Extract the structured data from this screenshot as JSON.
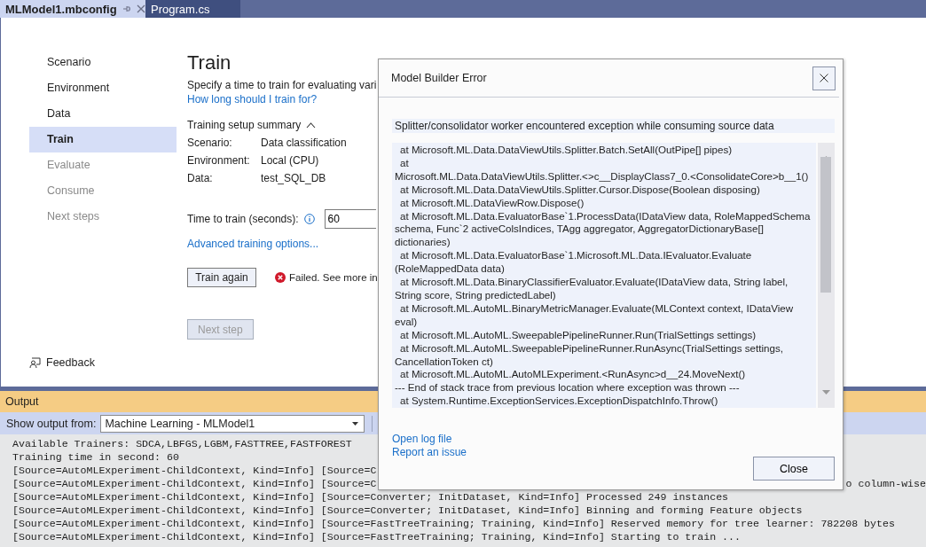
{
  "tabs": [
    {
      "label": "MLModel1.mbconfig",
      "selected": true
    },
    {
      "label": "Program.cs",
      "selected": false
    }
  ],
  "sidebar": {
    "items": [
      {
        "label": "Scenario",
        "selected": false,
        "disabled": false
      },
      {
        "label": "Environment",
        "selected": false,
        "disabled": false
      },
      {
        "label": "Data",
        "selected": false,
        "disabled": false
      },
      {
        "label": "Train",
        "selected": true,
        "disabled": false
      },
      {
        "label": "Evaluate",
        "selected": false,
        "disabled": true
      },
      {
        "label": "Consume",
        "selected": false,
        "disabled": true
      },
      {
        "label": "Next steps",
        "selected": false,
        "disabled": true
      }
    ],
    "feedback": "Feedback"
  },
  "train": {
    "title": "Train",
    "description": "Specify a time to train for evaluating vari",
    "help_link": "How long should I train for?",
    "summary": {
      "header": "Training setup summary",
      "expanded": true,
      "rows": [
        {
          "label": "Scenario:",
          "value": "Data classification"
        },
        {
          "label": "Environment:",
          "value": "Local (CPU)"
        },
        {
          "label": "Data:",
          "value": "test_SQL_DB"
        }
      ]
    },
    "time_label": "Time to train (seconds):",
    "time_value": "60",
    "advanced_link": "Advanced training options...",
    "train_button": "Train again",
    "status": {
      "kind": "error",
      "text": "Failed. See more in"
    },
    "next_button": {
      "label": "Next step",
      "disabled": true
    }
  },
  "output": {
    "title": "Output",
    "source_label": "Show output from:",
    "source": "Machine Learning - MLModel1",
    "lines": [
      {
        "left": "Available Trainers: SDCA,LBFGS,LGBM,FASTTREE,FASTFOREST"
      },
      {
        "left": "Training time in second: 60"
      },
      {
        "left": "[Source=AutoMLExperiment-ChildContext, Kind=Info] [Source=C"
      },
      {
        "left": "[Source=AutoMLExperiment-ChildContext, Kind=Info] [Source=C",
        "right": "o column-wise"
      },
      {
        "left": "[Source=AutoMLExperiment-ChildContext, Kind=Info] [Source=Converter; InitDataset, Kind=Info] Processed 249 instances"
      },
      {
        "left": "[Source=AutoMLExperiment-ChildContext, Kind=Info] [Source=Converter; InitDataset, Kind=Info] Binning and forming Feature objects"
      },
      {
        "left": "[Source=AutoMLExperiment-ChildContext, Kind=Info] [Source=FastTreeTraining; Training, Kind=Info] Reserved memory for tree learner: 782208 bytes"
      },
      {
        "left": "[Source=AutoMLExperiment-ChildContext, Kind=Info] [Source=FastTreeTraining; Training, Kind=Info] Starting to train ..."
      }
    ]
  },
  "dialog": {
    "title": "Model Builder Error",
    "message": "Splitter/consolidator worker encountered exception while consuming source data",
    "trace": [
      {
        "kind": "frame",
        "text": "at Microsoft.ML.Data.DataViewUtils.Splitter.Batch.SetAll(OutPipe[] pipes)"
      },
      {
        "kind": "frame",
        "text": "at"
      },
      {
        "kind": "wrap",
        "text": "Microsoft.ML.Data.DataViewUtils.Splitter.<>c__DisplayClass7_0.<ConsolidateCore>b__1()"
      },
      {
        "kind": "frame",
        "text": "at Microsoft.ML.Data.DataViewUtils.Splitter.Cursor.Dispose(Boolean disposing)"
      },
      {
        "kind": "frame",
        "text": "at Microsoft.ML.DataViewRow.Dispose()"
      },
      {
        "kind": "frame",
        "text": "at Microsoft.ML.Data.EvaluatorBase`1.ProcessData(IDataView data, RoleMappedSchema"
      },
      {
        "kind": "wrap",
        "text": "schema, Func`2 activeColsIndices, TAgg aggregator, AggregatorDictionaryBase[]"
      },
      {
        "kind": "wrap",
        "text": "dictionaries)"
      },
      {
        "kind": "frame",
        "text": "at Microsoft.ML.Data.EvaluatorBase`1.Microsoft.ML.Data.IEvaluator.Evaluate"
      },
      {
        "kind": "wrap",
        "text": "(RoleMappedData data)"
      },
      {
        "kind": "frame",
        "text": "at Microsoft.ML.Data.BinaryClassifierEvaluator.Evaluate(IDataView data, String label,"
      },
      {
        "kind": "wrap",
        "text": "String score, String predictedLabel)"
      },
      {
        "kind": "frame",
        "text": "at Microsoft.ML.AutoML.BinaryMetricManager.Evaluate(MLContext context, IDataView"
      },
      {
        "kind": "wrap",
        "text": "eval)"
      },
      {
        "kind": "frame",
        "text": "at Microsoft.ML.AutoML.SweepablePipelineRunner.Run(TrialSettings settings)"
      },
      {
        "kind": "frame",
        "text": "at Microsoft.ML.AutoML.SweepablePipelineRunner.RunAsync(TrialSettings settings,"
      },
      {
        "kind": "wrap",
        "text": "CancellationToken ct)"
      },
      {
        "kind": "frame",
        "text": "at Microsoft.ML.AutoML.AutoMLExperiment.<RunAsync>d__24.MoveNext()"
      },
      {
        "kind": "wrap",
        "text": "--- End of stack trace from previous location where exception was thrown ---"
      },
      {
        "kind": "frame",
        "text": "at System.Runtime.ExceptionServices.ExceptionDispatchInfo.Throw()"
      }
    ],
    "links": [
      "Open log file",
      "Report an issue"
    ],
    "close_button": "Close"
  }
}
